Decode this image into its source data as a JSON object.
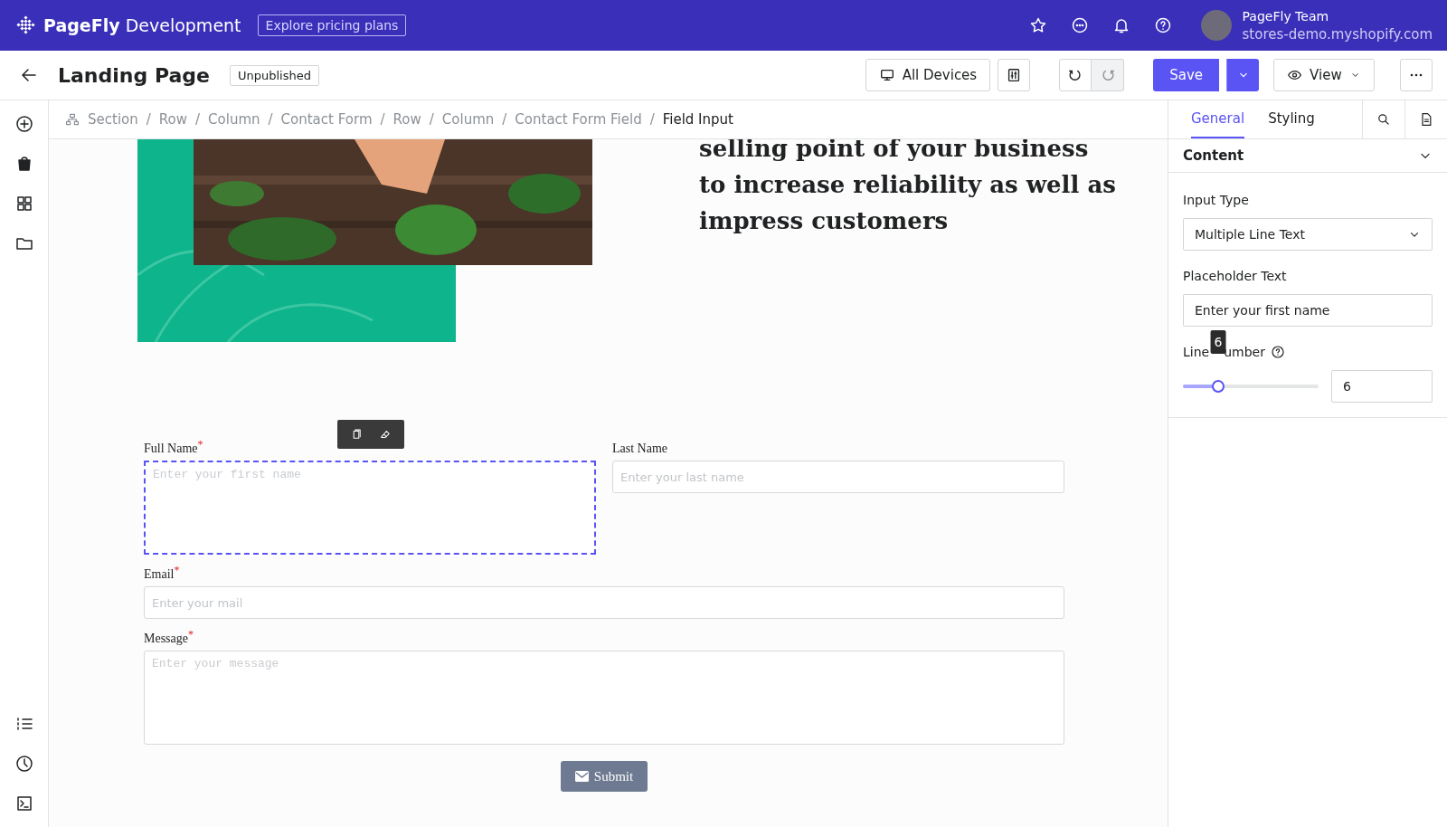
{
  "topbar": {
    "brand_bold": "PageFly",
    "brand_rest": "Development",
    "pricing_button": "Explore pricing plans",
    "user_name": "PageFly Team",
    "store": "stores-demo.myshopify.com"
  },
  "header": {
    "title": "Landing Page",
    "status": "Unpublished",
    "devices_button": "All Devices",
    "undo_disabled": false,
    "redo_disabled": true,
    "save_button": "Save",
    "view_button": "View"
  },
  "breadcrumb": [
    {
      "label": "Section",
      "current": false
    },
    {
      "separator": "/",
      "label": "Row",
      "current": false
    },
    {
      "separator": "/",
      "label": "Column",
      "current": false
    },
    {
      "separator": "/",
      "label": "Contact Form",
      "current": false
    },
    {
      "separator": "/",
      "label": "Row",
      "current": false
    },
    {
      "separator": "/",
      "label": "Column",
      "current": false
    },
    {
      "separator": "/",
      "label": "Contact Form Field",
      "current": false
    },
    {
      "separator": "/",
      "label": "Field Input",
      "current": true
    }
  ],
  "canvas": {
    "hero": {
      "image": {
        "kind": "picture"
      },
      "heading_lines": [
        "selling point of your business",
        "to increase reliability as well as",
        "impress customers"
      ]
    },
    "form": {
      "fields": [
        {
          "label": "Full Name",
          "required_mark": "*",
          "kind": "textarea",
          "placeholder": "Enter your first name",
          "selected": true
        },
        {
          "label": "Last Name",
          "kind": "input",
          "placeholder": "Enter your last name",
          "selected": false
        },
        {
          "label": "Email",
          "required_mark": "*",
          "kind": "input",
          "placeholder": "Enter your mail",
          "selected": false
        },
        {
          "label": "Message",
          "required_mark": "*",
          "kind": "textarea",
          "placeholder": "Enter your message",
          "selected": false
        }
      ],
      "submit_button": "Submit"
    }
  },
  "panel": {
    "tabs": [
      {
        "label": "General",
        "selected": true
      },
      {
        "label": "Styling",
        "selected": false
      }
    ],
    "section": {
      "title": "Content",
      "expanded": true
    },
    "input_type": {
      "label": "Input Type",
      "value": "Multiple Line Text"
    },
    "placeholder_text": {
      "label": "Placeholder Text",
      "value": "Enter your first name"
    },
    "line_number": {
      "label_start": "Line",
      "label_end": "umber",
      "level": 0.26,
      "tooltip": "6",
      "value": "6"
    }
  }
}
